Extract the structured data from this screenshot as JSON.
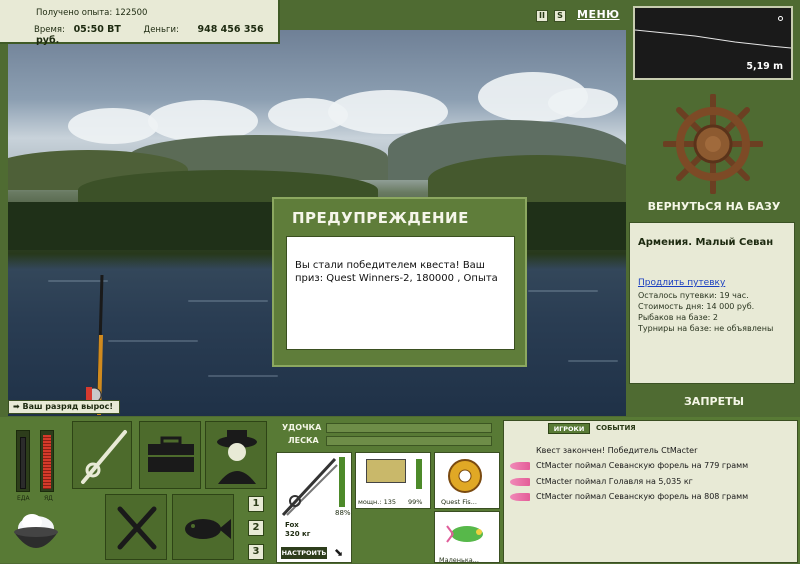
{
  "info": {
    "exp_label": "Получено опыта:",
    "exp_value": "122500",
    "time_label": "Время:",
    "time_value": "05:50 ВТ",
    "money_label": "Деньги:",
    "money_value": "948 456 356 руб."
  },
  "toolbar": {
    "pause_label": "II",
    "s_label": "S",
    "menu_label": "МЕНЮ"
  },
  "depth": {
    "value": "5,19 m"
  },
  "base": {
    "return_label": "ВЕРНУТЬСЯ НА БАЗУ",
    "title": "Армения. Малый Севан",
    "extend_link": "Продлить путевку",
    "lines": [
      "Осталось путевки: 19 час.",
      "Стоимость дня: 14 000 руб.",
      "Рыбаков на базе: 2",
      "Турниры на базе: не объявлены"
    ],
    "forbid_label": "ЗАПРЕТЫ"
  },
  "dialog": {
    "title": "ПРЕДУПРЕЖДЕНИЕ",
    "message": "Вы стали победителем квеста! Ваш приз: Quest Winners-2, 180000 , Опыта"
  },
  "rank_notice": "Ваш разряд вырос!",
  "gauges": {
    "food_label": "ЕДА",
    "poison_label": "ЯД"
  },
  "pages": [
    "1",
    "2",
    "3"
  ],
  "tackle": {
    "rod_label": "УДОЧКА",
    "line_label": "ЛЕСКА",
    "rod_name": "Fox",
    "rod_load": "320 кг",
    "rod_pct": "88%",
    "reel_power": "мощн.: 135",
    "reel_pct": "99%",
    "line_name": "Quest Fis...",
    "lure_name": "Маленька...",
    "build_label": "НАСТРОИТЬ"
  },
  "events": {
    "tab_players": "ИГРОКИ",
    "tab_events": "СОБЫТИЯ",
    "items": [
      "Квест закончен! Победитель CtMacter",
      "CtMacter поймал Севанскую форель на 779 грамм",
      "CtMacter поймал Голавля на 5,035 кг",
      "CtMacter поймал Севанскую форель на 808 грамм"
    ]
  },
  "colors": {
    "panel_green": "#587a35",
    "panel_cream": "#e8ead6",
    "accent_red": "#c0392b"
  }
}
